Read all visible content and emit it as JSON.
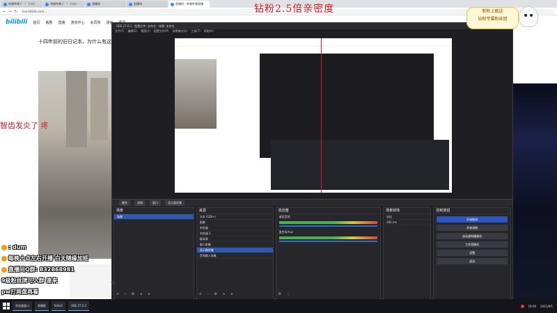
{
  "overlay": {
    "top_title": "钻粉2.5倍亲密度",
    "left_caption": "智齿发炎了 疼",
    "badge_line1": "新粉上舰送",
    "badge_line2": "钻粉专属粉丝团"
  },
  "browser": {
    "tabs": [
      "哔哩哔哩 (゜-゜)つロ",
      "哔哩哔哩 (゜-゜)つロ",
      "直播间",
      "直播间",
      "直播间 - 哔哩哔哩直播"
    ],
    "url": "live.bilibili.com/..."
  },
  "site": {
    "logo": "bilibili",
    "nav": [
      "首页",
      "番剧",
      "直播",
      "游戏中心",
      "会员购",
      "漫画",
      "赛事"
    ],
    "headline": "十四年前的旧日记本，为什么有这么多..."
  },
  "obs": {
    "window_title": "OBS 27.0.1 - 配置文件: 未命名 - 场景: 未命名",
    "menu": [
      "文件(F)",
      "编辑(E)",
      "视图(V)",
      "配置文件(P)",
      "场景集合(S)",
      "工具(T)",
      "帮助(H)"
    ],
    "source_bar_items": [
      "属性",
      "滤镜",
      "窗口",
      "显示器采集"
    ],
    "docks": {
      "scenes": {
        "title": "场景",
        "items": [
          "场景"
        ]
      },
      "sources": {
        "title": "来源",
        "items": [
          "文本 (GDI+)",
          "图像",
          "浏览器",
          "浏览器 2",
          "媒体源",
          "窗口采集",
          "显示器采集",
          "音频输入采集"
        ]
      },
      "mixer": {
        "title": "混音器",
        "channels": [
          "桌面音频",
          "麦克风/Aux"
        ]
      },
      "transitions": {
        "title": "场景转场",
        "type": "淡出",
        "duration": "300 ms"
      },
      "controls": {
        "title": "控制按钮",
        "buttons": [
          "开始推流",
          "开始录制",
          "启动虚拟摄像机",
          "工作室模式",
          "设置",
          "退出"
        ]
      }
    }
  },
  "chat": {
    "lines": [
      ": dum",
      "每晚十点左右开播 白天随缘加班",
      "直播间Q群: 832868981",
      "9级粉丝牌可入群 速来",
      "pw打两盘再看"
    ]
  },
  "taskbar": {
    "items": [
      "浏览器窗口",
      "直播姬",
      "Bilibili",
      "OBS 27.0.1"
    ],
    "time": "19:00",
    "date": "2021/9/1"
  }
}
